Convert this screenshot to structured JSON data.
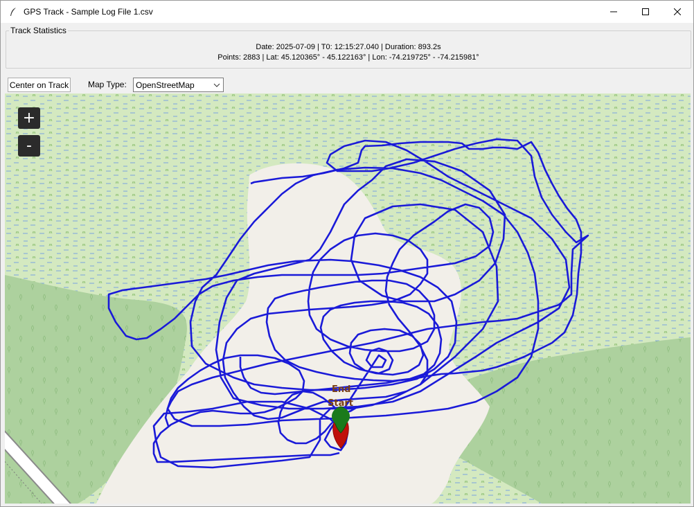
{
  "window": {
    "title": "GPS Track - Sample Log File 1.csv"
  },
  "stats": {
    "legend": "Track Statistics",
    "line1": "Date: 2025-07-09 | T0: 12:15:27.040 | Duration: 893.2s",
    "line2": "Points: 2883 | Lat: 45.120365° - 45.122163° | Lon: -74.219725° - -74.215981°"
  },
  "toolbar": {
    "center_label": "Center on Track",
    "map_type_label": "Map Type:",
    "map_type_value": "OpenStreetMap"
  },
  "map": {
    "zoom_in": "+",
    "zoom_out": "-",
    "start_label": "Start",
    "end_label": "End",
    "track_color": "#1a1ad8",
    "wetland_color": "#d4e9c0",
    "wood_color": "#add19e",
    "clearing_color": "#f2efe9",
    "start_marker_color": "#1b7a1b",
    "end_marker_color": "#c0100a"
  }
}
